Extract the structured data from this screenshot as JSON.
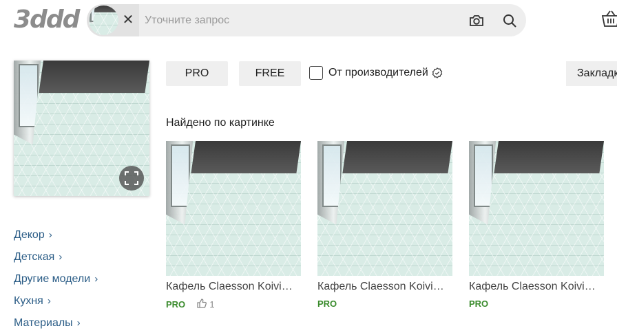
{
  "header": {
    "logo_text": "3ddd",
    "search": {
      "placeholder": "Уточните запрос",
      "value": "",
      "clear_symbol": "✕"
    }
  },
  "filters": {
    "pro_label": "PRO",
    "free_label": "FREE",
    "manufacturers_label": "От производителей",
    "manufacturers_checked": false,
    "bookmarks_label": "Закладки"
  },
  "results_heading": "Найдено по картинке",
  "categories": [
    {
      "label": "Декор"
    },
    {
      "label": "Детская"
    },
    {
      "label": "Другие модели"
    },
    {
      "label": "Кухня"
    },
    {
      "label": "Материалы"
    }
  ],
  "cards": [
    {
      "title": "Кафель Claesson Koivisto Rune",
      "badge": "PRO",
      "likes": "1"
    },
    {
      "title": "Кафель Claesson Koivisto Rune",
      "badge": "PRO"
    },
    {
      "title": "Кафель Claesson Koivisto Rune",
      "badge": "PRO"
    }
  ],
  "colors": {
    "accent_link": "#2a5c86",
    "pro_badge": "#3a8b2c",
    "pill_bg": "#efefef",
    "search_bg": "#eeeeee"
  },
  "icons": {
    "camera": "camera-icon",
    "search": "search-icon",
    "basket": "basket-icon",
    "expand": "expand-icon",
    "verified": "verified-icon",
    "like": "thumbs-up-icon",
    "chevron": "chevron-right-icon"
  }
}
